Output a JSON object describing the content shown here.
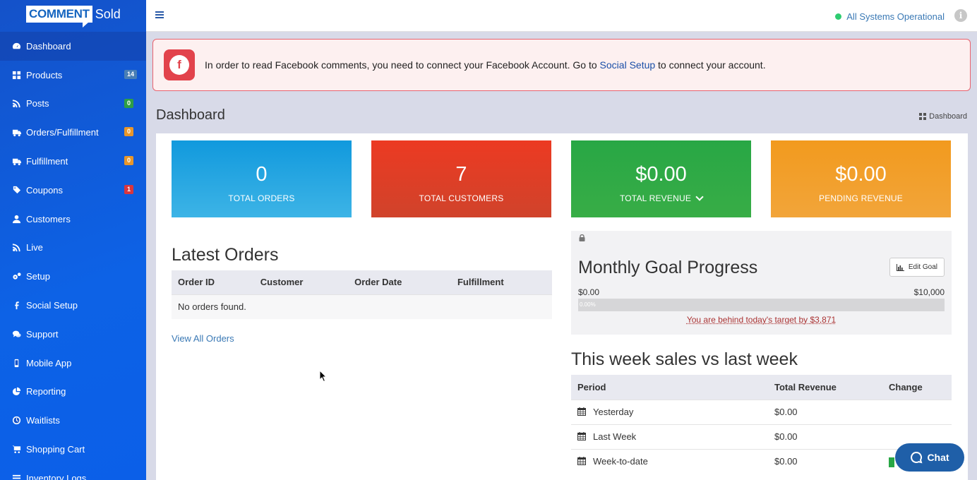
{
  "brand": {
    "logo_part1": "COMMENT",
    "logo_part2": "Sold"
  },
  "sidebar": {
    "items": [
      {
        "label": "Dashboard",
        "icon": "dashboard-icon",
        "badge": "",
        "active": true
      },
      {
        "label": "Products",
        "icon": "grid-icon",
        "badge": "14",
        "badge_color": "#4a7fb5"
      },
      {
        "label": "Posts",
        "icon": "rss-icon",
        "badge": "0",
        "badge_color": "#2e9e45"
      },
      {
        "label": "Orders/Fulfillment",
        "icon": "truck-icon",
        "badge": "0",
        "badge_color": "#e8962a"
      },
      {
        "label": "Fulfillment",
        "icon": "truck-icon",
        "badge": "0",
        "badge_color": "#e8962a"
      },
      {
        "label": "Coupons",
        "icon": "tag-icon",
        "badge": "1",
        "badge_color": "#d9363e"
      },
      {
        "label": "Customers",
        "icon": "user-icon",
        "badge": ""
      },
      {
        "label": "Live",
        "icon": "rss-icon",
        "badge": ""
      },
      {
        "label": "Setup",
        "icon": "cogs-icon",
        "badge": ""
      },
      {
        "label": "Social Setup",
        "icon": "facebook-icon",
        "badge": ""
      },
      {
        "label": "Support",
        "icon": "comments-icon",
        "badge": ""
      },
      {
        "label": "Mobile App",
        "icon": "mobile-icon",
        "badge": ""
      },
      {
        "label": "Reporting",
        "icon": "pie-chart-icon",
        "badge": ""
      },
      {
        "label": "Waitlists",
        "icon": "clock-icon",
        "badge": ""
      },
      {
        "label": "Shopping Cart",
        "icon": "cart-icon",
        "badge": ""
      },
      {
        "label": "Inventory Logs",
        "icon": "list-icon",
        "badge": ""
      }
    ]
  },
  "topbar": {
    "status": "All Systems Operational",
    "status_color": "#2ecc71"
  },
  "alert": {
    "text_before": "In order to read Facebook comments, you need to connect your Facebook Account. Go to ",
    "link": "Social Setup",
    "text_after": " to connect your account."
  },
  "header": {
    "title": "Dashboard",
    "breadcrumb": "Dashboard"
  },
  "stats": [
    {
      "value": "0",
      "label": "TOTAL ORDERS"
    },
    {
      "value": "7",
      "label": "TOTAL CUSTOMERS"
    },
    {
      "value": "$0.00",
      "label": "TOTAL REVENUE"
    },
    {
      "value": "$0.00",
      "label": "PENDING REVENUE"
    }
  ],
  "latest_orders": {
    "title": "Latest Orders",
    "columns": [
      "Order ID",
      "Customer",
      "Order Date",
      "Fulfillment"
    ],
    "empty": "No orders found.",
    "view_all": "View All Orders"
  },
  "goal": {
    "title": "Monthly Goal Progress",
    "edit_label": "Edit Goal",
    "min": "$0.00",
    "max": "$10,000",
    "progress_label": "0.00%",
    "progress": 0,
    "behind_text": "You are behind today's target by $3,871"
  },
  "week": {
    "title": "This week sales vs last week",
    "columns": [
      "Period",
      "Total Revenue",
      "Change"
    ],
    "rows": [
      {
        "period": "Yesterday",
        "revenue": "$0.00"
      },
      {
        "period": "Last Week",
        "revenue": "$0.00"
      },
      {
        "period": "Week-to-date",
        "revenue": "$0.00"
      }
    ]
  },
  "chat": {
    "label": "Chat"
  }
}
